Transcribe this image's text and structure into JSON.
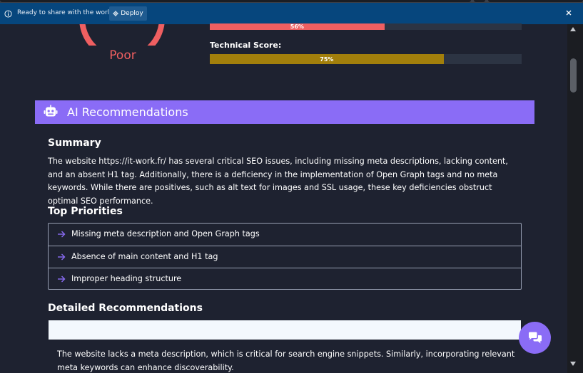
{
  "notification": {
    "message": "Ready to share with the world?",
    "deploy_label": "Deploy"
  },
  "score_card": {
    "rating": "Poor",
    "content_score": {
      "label_text": "56%",
      "value": 56,
      "color": "#ef5f61"
    },
    "technical_score": {
      "label": "Technical Score:",
      "label_text": "75%",
      "value": 75,
      "color": "#a27f0b"
    }
  },
  "ai_section": {
    "title": "AI Recommendations",
    "summary_heading": "Summary",
    "summary_text": "The website https://it-work.fr/ has several critical SEO issues, including missing meta descriptions, lacking content, and an absent H1 tag. Additionally, there is a deficiency in the implementation of Open Graph tags and no meta keywords. While there are positives, such as alt text for images and SSL usage, these key deficiencies obstruct optimal SEO performance.",
    "priorities_heading": "Top Priorities",
    "priorities": [
      "Missing meta description and Open Graph tags",
      "Absence of main content and H1 tag",
      "Improper heading structure"
    ],
    "detailed_heading": "Detailed Recommendations",
    "detailed_text": "The website lacks a meta description, which is critical for search engine snippets. Similarly, incorporating relevant meta keywords can enhance discoverability."
  },
  "colors": {
    "accent": "#8a6cf6",
    "poor": "#ef5f61",
    "technical": "#a27f0b",
    "notify_bg": "#06467d",
    "page_bg": "#1e2230"
  }
}
